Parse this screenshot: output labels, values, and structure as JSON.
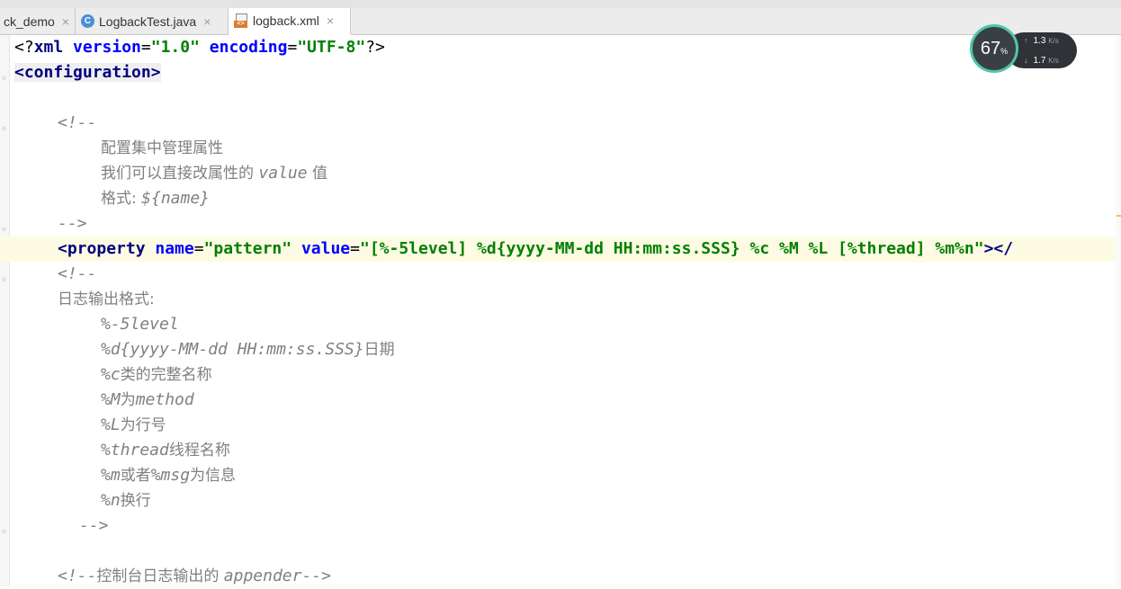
{
  "tabs": [
    {
      "label": "ck_demo",
      "icon": "none",
      "active": false
    },
    {
      "label": "LogbackTest.java",
      "icon": "java-class-icon",
      "active": false
    },
    {
      "label": "logback.xml",
      "icon": "xml-file-icon",
      "active": true
    }
  ],
  "close_glyph": "×",
  "widget": {
    "percent": "67",
    "percent_unit": "%",
    "upload": "1.3",
    "download": "1.7",
    "unit": "K/s"
  },
  "code": {
    "l1": {
      "open": "<?",
      "name": "xml",
      "a1": " version",
      "eq1": "=",
      "v1": "\"1.0\"",
      "a2": " encoding",
      "eq2": "=",
      "v2": "\"UTF-8\"",
      "close": "?>"
    },
    "l2": {
      "text": "<configuration>"
    },
    "l4": {
      "text": "<!--"
    },
    "l5": {
      "text": "配置集中管理属性"
    },
    "l6": {
      "zh1": "我们可以直接改属性的 ",
      "code": "value",
      "zh2": " 值"
    },
    "l7": {
      "zh": "格式: ",
      "code": "${name}"
    },
    "l8": {
      "text": "-->"
    },
    "l9": {
      "lt": "<",
      "tag": "property",
      "a1": " name",
      "eq1": "=",
      "v1": "\"pattern\"",
      "a2": " value",
      "eq2": "=",
      "v2": "\"[%-5level] %d{yyyy-MM-dd HH:mm:ss.SSS} %c %M %L [%thread] %m%n\"",
      "end": "></"
    },
    "l10": {
      "text": "<!--"
    },
    "l11": {
      "text": "日志输出格式:"
    },
    "l12": {
      "code": "%-5level"
    },
    "l13": {
      "code": "%d{yyyy-MM-dd HH:mm:ss.SSS}",
      "zh": "日期"
    },
    "l14": {
      "code": "%c",
      "zh": "类的完整名称"
    },
    "l15": {
      "code1": "%M",
      "zh": "为",
      "code2": "method"
    },
    "l16": {
      "code": "%L",
      "zh": "为行号"
    },
    "l17": {
      "code": "%thread",
      "zh": "线程名称"
    },
    "l18": {
      "code1": "%m",
      "zh1": "或者",
      "code2": "%msg",
      "zh2": "为信息"
    },
    "l19": {
      "code": "%n",
      "zh": "换行"
    },
    "l20": {
      "text": "-->"
    },
    "l22": {
      "c1": "<!--",
      "zh": "控制台日志输出的 ",
      "c2": "appender-->"
    }
  },
  "colors": {
    "tag": "#000080",
    "attribute": "#0000ff",
    "string": "#008000",
    "comment": "#808080",
    "caret_line": "#fdfbe3",
    "widget_ring": "#4fc7a5"
  }
}
